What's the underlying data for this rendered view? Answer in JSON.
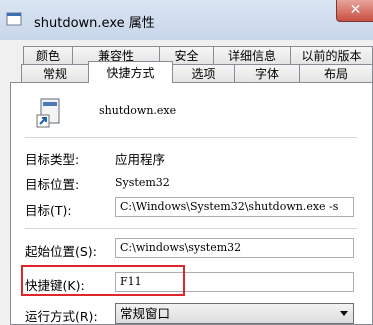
{
  "window": {
    "title": "shutdown.exe 属性",
    "close_glyph": "✕"
  },
  "tabs_back": [
    "颜色",
    "兼容性",
    "安全",
    "详细信息",
    "以前的版本"
  ],
  "tabs_front": [
    "常规",
    "快捷方式",
    "选项",
    "字体",
    "布局"
  ],
  "active_tab": "快捷方式",
  "shortcut": {
    "name": "shutdown.exe",
    "target_type_label": "目标类型:",
    "target_type_value": "应用程序",
    "target_location_label": "目标位置:",
    "target_location_value": "System32",
    "target_label": "目标(T):",
    "target_value": "C:\\Windows\\System32\\shutdown.exe -s",
    "start_in_label": "起始位置(S):",
    "start_in_value": "C:\\windows\\system32",
    "hotkey_label": "快捷键(K):",
    "hotkey_value": "F11",
    "run_label": "运行方式(R):",
    "run_value": "常规窗口"
  },
  "colors": {
    "highlight": "#e0262d",
    "titlebar": "#cfdcee"
  }
}
